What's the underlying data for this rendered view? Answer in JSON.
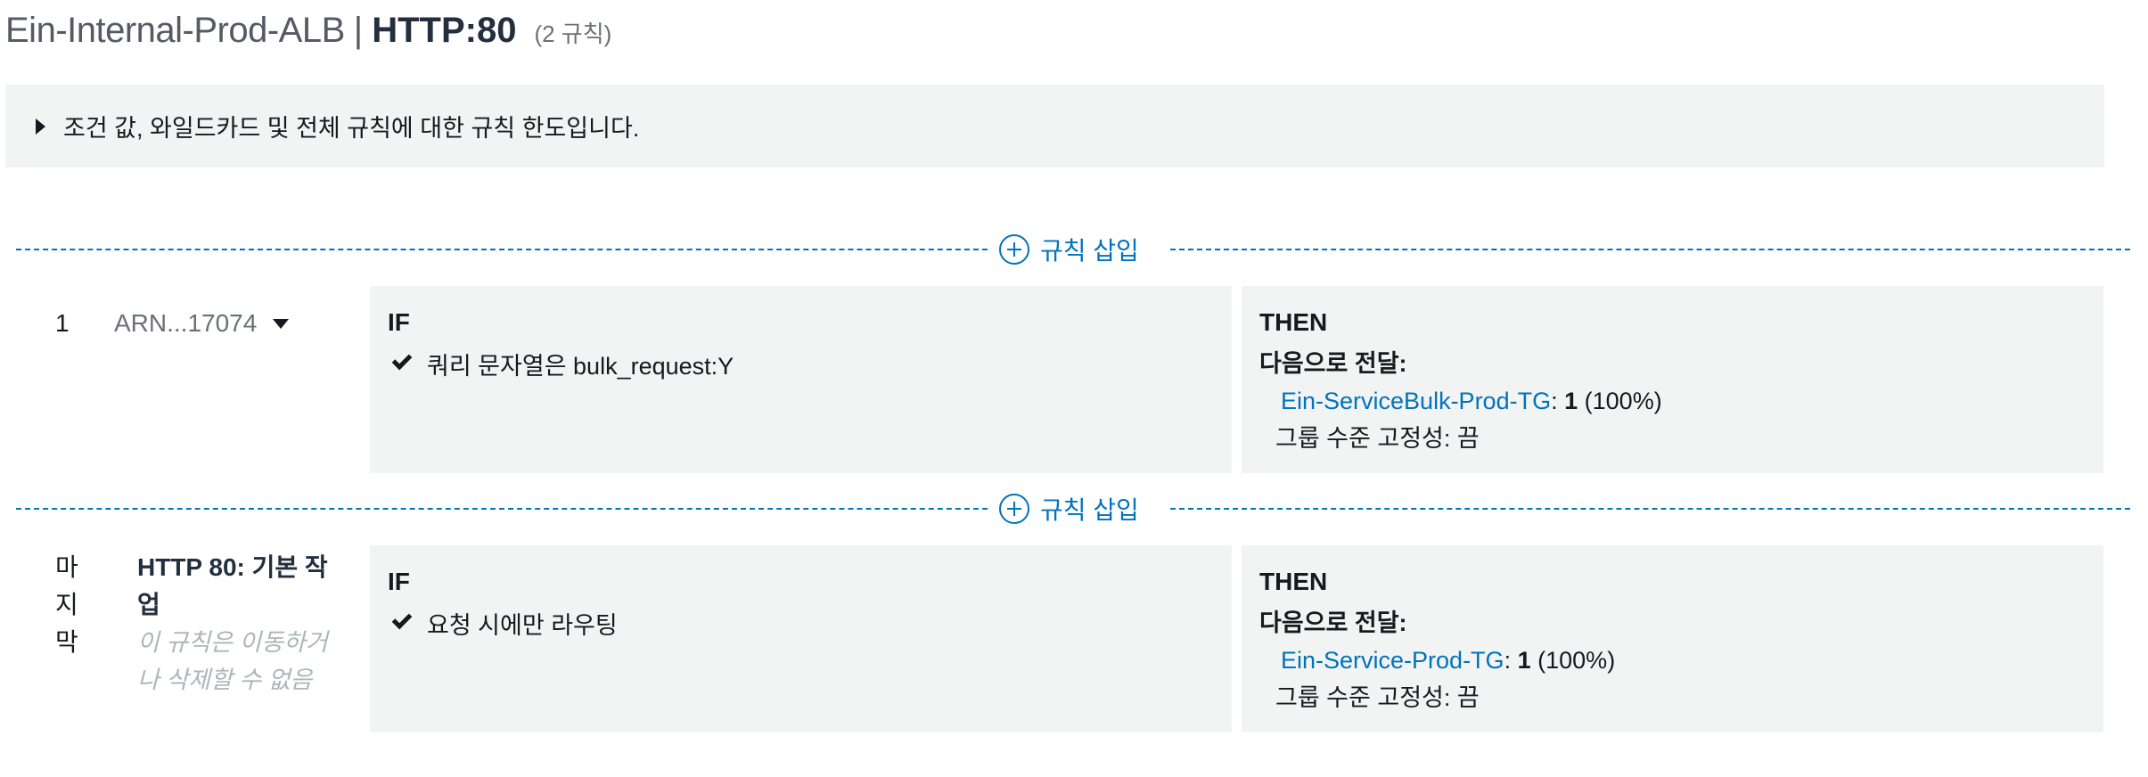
{
  "header": {
    "load_balancer": "Ein-Internal-Prod-ALB",
    "separator": "|",
    "listener": "HTTP:80",
    "rule_count": "(2 규칙)"
  },
  "limits_panel": {
    "text": "조건 값, 와일드카드 및 전체 규칙에 대한 규칙 한도입니다."
  },
  "insert_label": "규칙 삽입",
  "rules": [
    {
      "number": "1",
      "arn": "ARN...17074",
      "if_label": "IF",
      "condition": "쿼리 문자열은 bulk_request:Y",
      "then_label": "THEN",
      "forward_label": "다음으로 전달:",
      "target_group": "Ein-ServiceBulk-Prod-TG",
      "weight_sep": ":",
      "weight": "1",
      "weight_pct": "(100%)",
      "stickiness": "그룹 수준 고정성: 끔"
    },
    {
      "number_lines": [
        "마",
        "지",
        "막"
      ],
      "name": "HTTP 80: 기본 작업",
      "note": "이 규칙은 이동하거나 삭제할 수 없음",
      "if_label": "IF",
      "condition": "요청 시에만 라우팅",
      "then_label": "THEN",
      "forward_label": "다음으로 전달:",
      "target_group": "Ein-Service-Prod-TG",
      "weight_sep": ":",
      "weight": "1",
      "weight_pct": "(100%)",
      "stickiness": "그룹 수준 고정성: 끔"
    }
  ]
}
